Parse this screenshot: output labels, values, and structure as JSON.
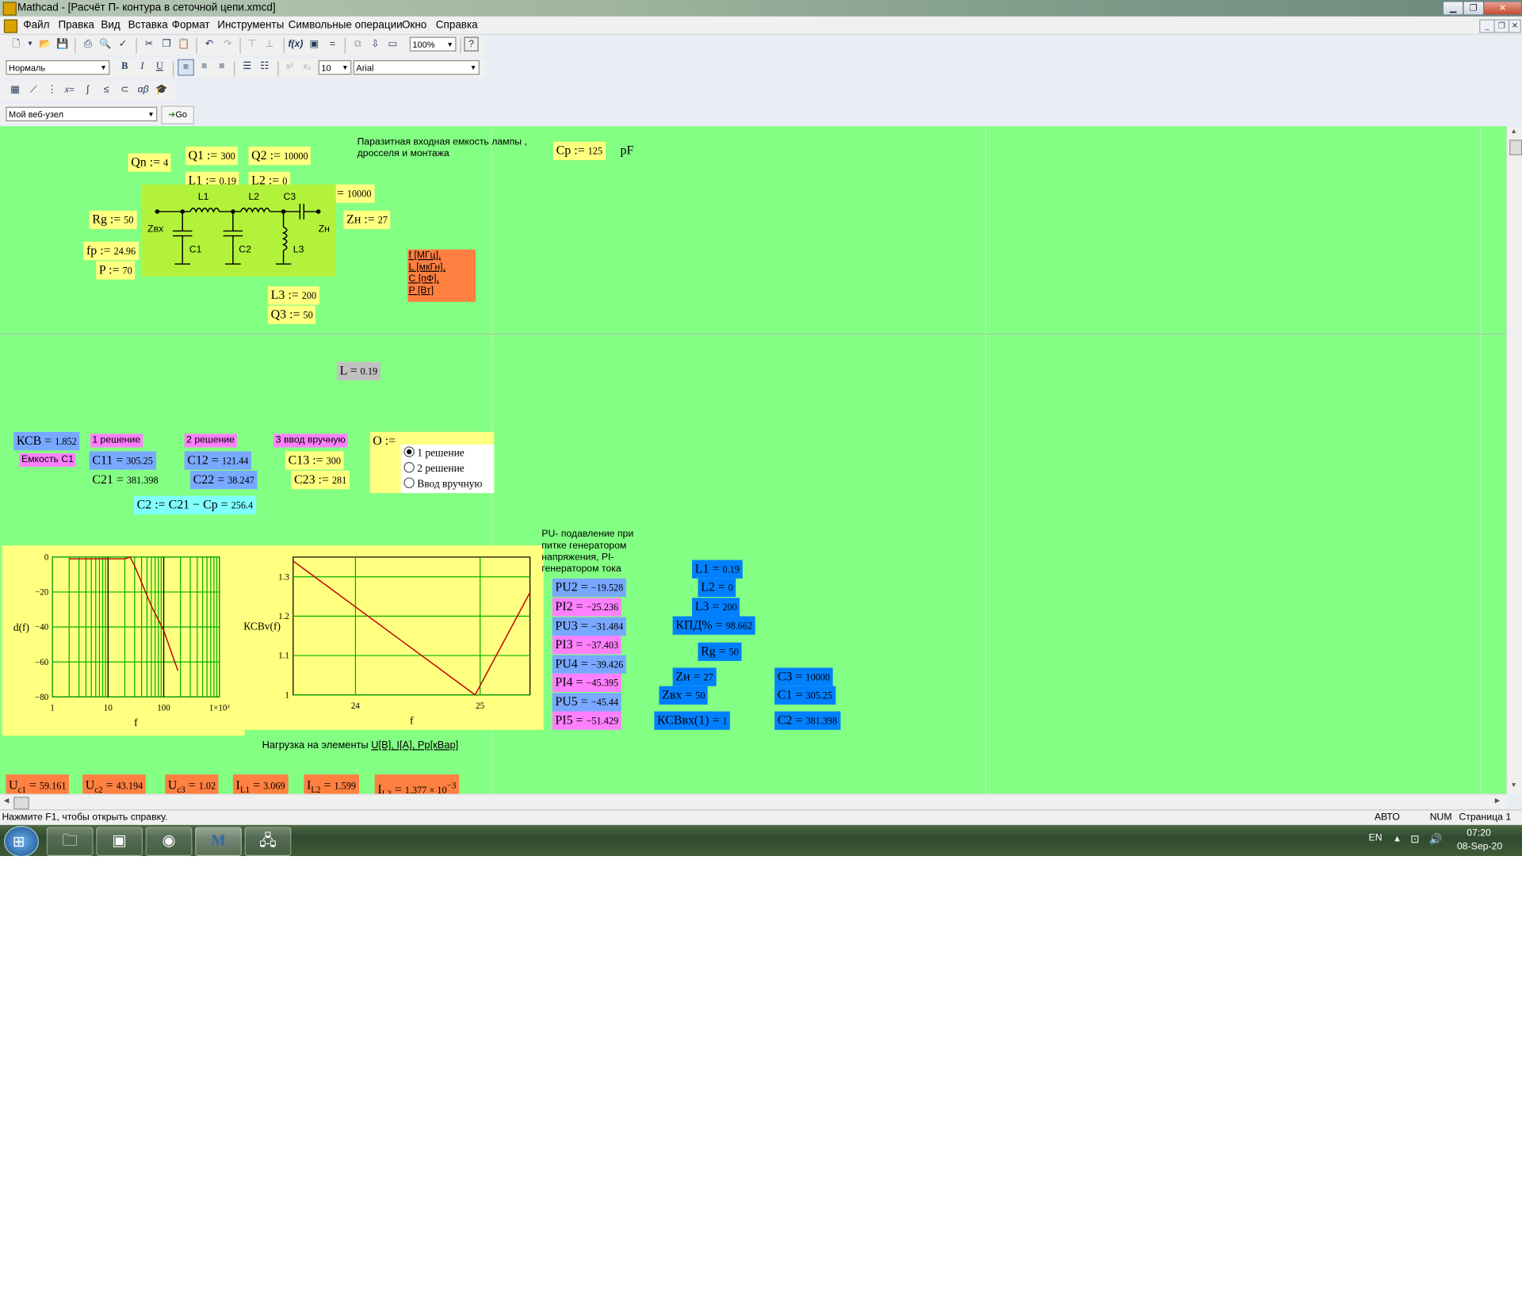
{
  "window": {
    "title": "Mathcad - [Расчёт П- контура в сеточной цепи.xmcd]"
  },
  "menu": [
    "Файл",
    "Правка",
    "Вид",
    "Вставка",
    "Формат",
    "Инструменты",
    "Символьные операции",
    "Окно",
    "Справка"
  ],
  "format": {
    "style": "Нормаль",
    "size": "10",
    "font": "Arial",
    "zoom": "100%"
  },
  "web": {
    "resource": "Мой веб-узел",
    "go": "Go"
  },
  "icons": {
    "new": "new-file-icon",
    "open": "open-icon",
    "save": "save-icon",
    "print": "print-icon",
    "preview": "print-preview-icon",
    "spell": "spell-check-icon",
    "cut": "cut-icon",
    "copy": "copy-icon",
    "paste": "paste-icon",
    "undo": "undo-icon",
    "redo": "redo-icon",
    "help": "help-icon"
  },
  "sheet": {
    "cap_note": "Паразитная входная емкость лампы , дросселя и монтажа",
    "cp": {
      "name": "Cp",
      "val": "125",
      "unit": "pF"
    },
    "qn": {
      "name": "Qn",
      "val": "4"
    },
    "q1": {
      "name": "Q1",
      "val": "300"
    },
    "q2": {
      "name": "Q2",
      "val": "10000"
    },
    "l1": {
      "name": "L1",
      "val": "0.19"
    },
    "l2": {
      "name": "L2",
      "val": "0"
    },
    "c3": {
      "name": "C3",
      "val": "10000"
    },
    "rg": {
      "name": "Rg",
      "val": "50"
    },
    "zn": {
      "name": "Zн",
      "val": "27"
    },
    "fp": {
      "name": "fp",
      "val": "24.96"
    },
    "p": {
      "name": "P",
      "val": "70"
    },
    "l3": {
      "name": "L3",
      "val": "200"
    },
    "q3": {
      "name": "Q3",
      "val": "50"
    },
    "units": [
      "f [МГц],",
      "L [мкГн],",
      "C [пФ],",
      "P [Вт]"
    ],
    "circuit": {
      "l1": "L1",
      "l2": "L2",
      "c3": "C3",
      "zvx": "Zвх",
      "zn": "Zн",
      "c1": "C1",
      "c2": "C2",
      "l3": "L3"
    },
    "l_res": {
      "name": "L",
      "val": "0.19"
    },
    "ksv": {
      "name": "КСВ",
      "val": "1.852"
    },
    "sol1": "1 решение",
    "sol2": "2 решение",
    "sol3": "3 ввод вручную",
    "cap_c1": "Емкость C1",
    "c11": {
      "name": "C11",
      "val": "305.25"
    },
    "c12": {
      "name": "C12",
      "val": "121.44"
    },
    "c13": {
      "name": "C13",
      "val": "300"
    },
    "c21": {
      "name": "C21",
      "val": "381.398"
    },
    "c22": {
      "name": "C22",
      "val": "38.247"
    },
    "c23": {
      "name": "C23",
      "val": "281"
    },
    "o_name": "O",
    "radio": [
      "1 решение",
      "2 решение",
      "Ввод вручную"
    ],
    "c2_expr": {
      "lhs": "C2",
      "rhs": "C21 − Cp",
      "val": "256.4"
    },
    "pu_note": "PU- подавление при питке генератором напряжения, PI- генератором тока",
    "pu": [
      {
        "name": "PU2",
        "val": "−19.528"
      },
      {
        "name": "PI2",
        "val": "−25.236"
      },
      {
        "name": "PU3",
        "val": "−31.484"
      },
      {
        "name": "PI3",
        "val": "−37.403"
      },
      {
        "name": "PU4",
        "val": "−39.426"
      },
      {
        "name": "PI4",
        "val": "−45.395"
      },
      {
        "name": "PU5",
        "val": "−45.44"
      },
      {
        "name": "PI5",
        "val": "−51.429"
      }
    ],
    "r_l1": {
      "name": "L1",
      "val": "0.19"
    },
    "r_l2": {
      "name": "L2",
      "val": "0"
    },
    "r_l3": {
      "name": "L3",
      "val": "200"
    },
    "eff": {
      "name": "КПД%",
      "val": "98.662"
    },
    "r_rg": {
      "name": "Rg",
      "val": "50"
    },
    "r_zn": {
      "name": "Zн",
      "val": "27"
    },
    "r_zvx": {
      "name": "Zвх",
      "val": "50"
    },
    "r_ksvin": {
      "name": "КСВвх(1)",
      "val": "1"
    },
    "r_c3": {
      "name": "C3",
      "val": "10000"
    },
    "r_c1": {
      "name": "C1",
      "val": "305.25"
    },
    "r_c2": {
      "name": "C2",
      "val": "381.398"
    },
    "load_note": "Нагрузка на элементы",
    "load_units": "U[В], I[А], Pр[кВар]",
    "load": [
      {
        "name": "U",
        "sub": "c1",
        "val": "59.161"
      },
      {
        "name": "U",
        "sub": "c2",
        "val": "43.194"
      },
      {
        "name": "U",
        "sub": "c3",
        "val": "1.02"
      },
      {
        "name": "I",
        "sub": "L1",
        "val": "3.069"
      },
      {
        "name": "I",
        "sub": "L2",
        "val": "1.599"
      },
      {
        "name": "I",
        "sub": "L3",
        "val": "1.377 × 10",
        "exp": "−3"
      }
    ]
  },
  "chart_data": [
    {
      "type": "line",
      "title": "",
      "xlabel": "f",
      "ylabel": "d(f)",
      "x_scale": "log",
      "xlim": [
        1,
        1000
      ],
      "ylim": [
        -80,
        0
      ],
      "x_tick_labels": [
        "1",
        "10",
        "100",
        "1×10³"
      ],
      "y_tick_labels": [
        "0",
        "−20",
        "−40",
        "−60",
        "−80"
      ],
      "grid": true,
      "series": [
        {
          "color": "#c00000",
          "points": [
            [
              2,
              -1
            ],
            [
              20,
              -1
            ],
            [
              24.96,
              0
            ],
            [
              30,
              -5
            ],
            [
              60,
              -28
            ],
            [
              100,
              -42
            ],
            [
              150,
              -58
            ],
            [
              180,
              -65
            ]
          ]
        }
      ]
    },
    {
      "type": "line",
      "title": "",
      "xlabel": "f",
      "ylabel": "КСВv(f)",
      "xlim": [
        23.5,
        25.4
      ],
      "ylim": [
        1,
        1.35
      ],
      "x_tick_labels": [
        "24",
        "25"
      ],
      "y_tick_labels": [
        "1.3",
        "1.2",
        "1.1",
        "1"
      ],
      "grid": true,
      "series": [
        {
          "color": "#c00000",
          "points": [
            [
              23.5,
              1.34
            ],
            [
              24.96,
              1.0
            ],
            [
              25.4,
              1.26
            ]
          ]
        }
      ]
    }
  ],
  "status": {
    "help": "Нажмите F1, чтобы открыть справку.",
    "mode": "АВТО",
    "num": "NUM",
    "page": "Страница 1"
  },
  "tray": {
    "lang": "EN",
    "time": "07:20",
    "date": "08-Sep-20"
  }
}
